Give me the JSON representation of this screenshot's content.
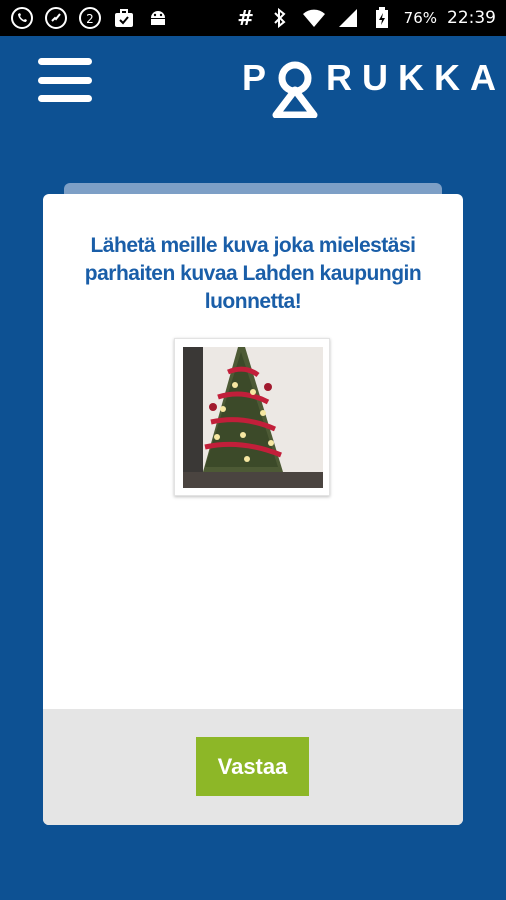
{
  "status_bar": {
    "left_icons": [
      "viber-icon",
      "phone-call-icon",
      "skype-icon",
      "briefcase-check-icon",
      "android-icon"
    ],
    "right_icons": [
      "hash-icon",
      "bluetooth-icon",
      "wifi-icon",
      "signal-icon",
      "battery-charging-icon"
    ],
    "battery_percent": "76%",
    "time": "22:39"
  },
  "header": {
    "menu_icon": "hamburger-menu-icon",
    "logo_text": "PORUKKA"
  },
  "card": {
    "question": "Lähetä meille kuva joka mielestäsi parhaiten kuvaa Lahden kaupungin luonnetta!",
    "answer_button": "Vastaa"
  },
  "colors": {
    "background": "#0d5193",
    "question_text": "#1a5ea8",
    "button": "#8db727",
    "footer": "#e5e5e5"
  }
}
